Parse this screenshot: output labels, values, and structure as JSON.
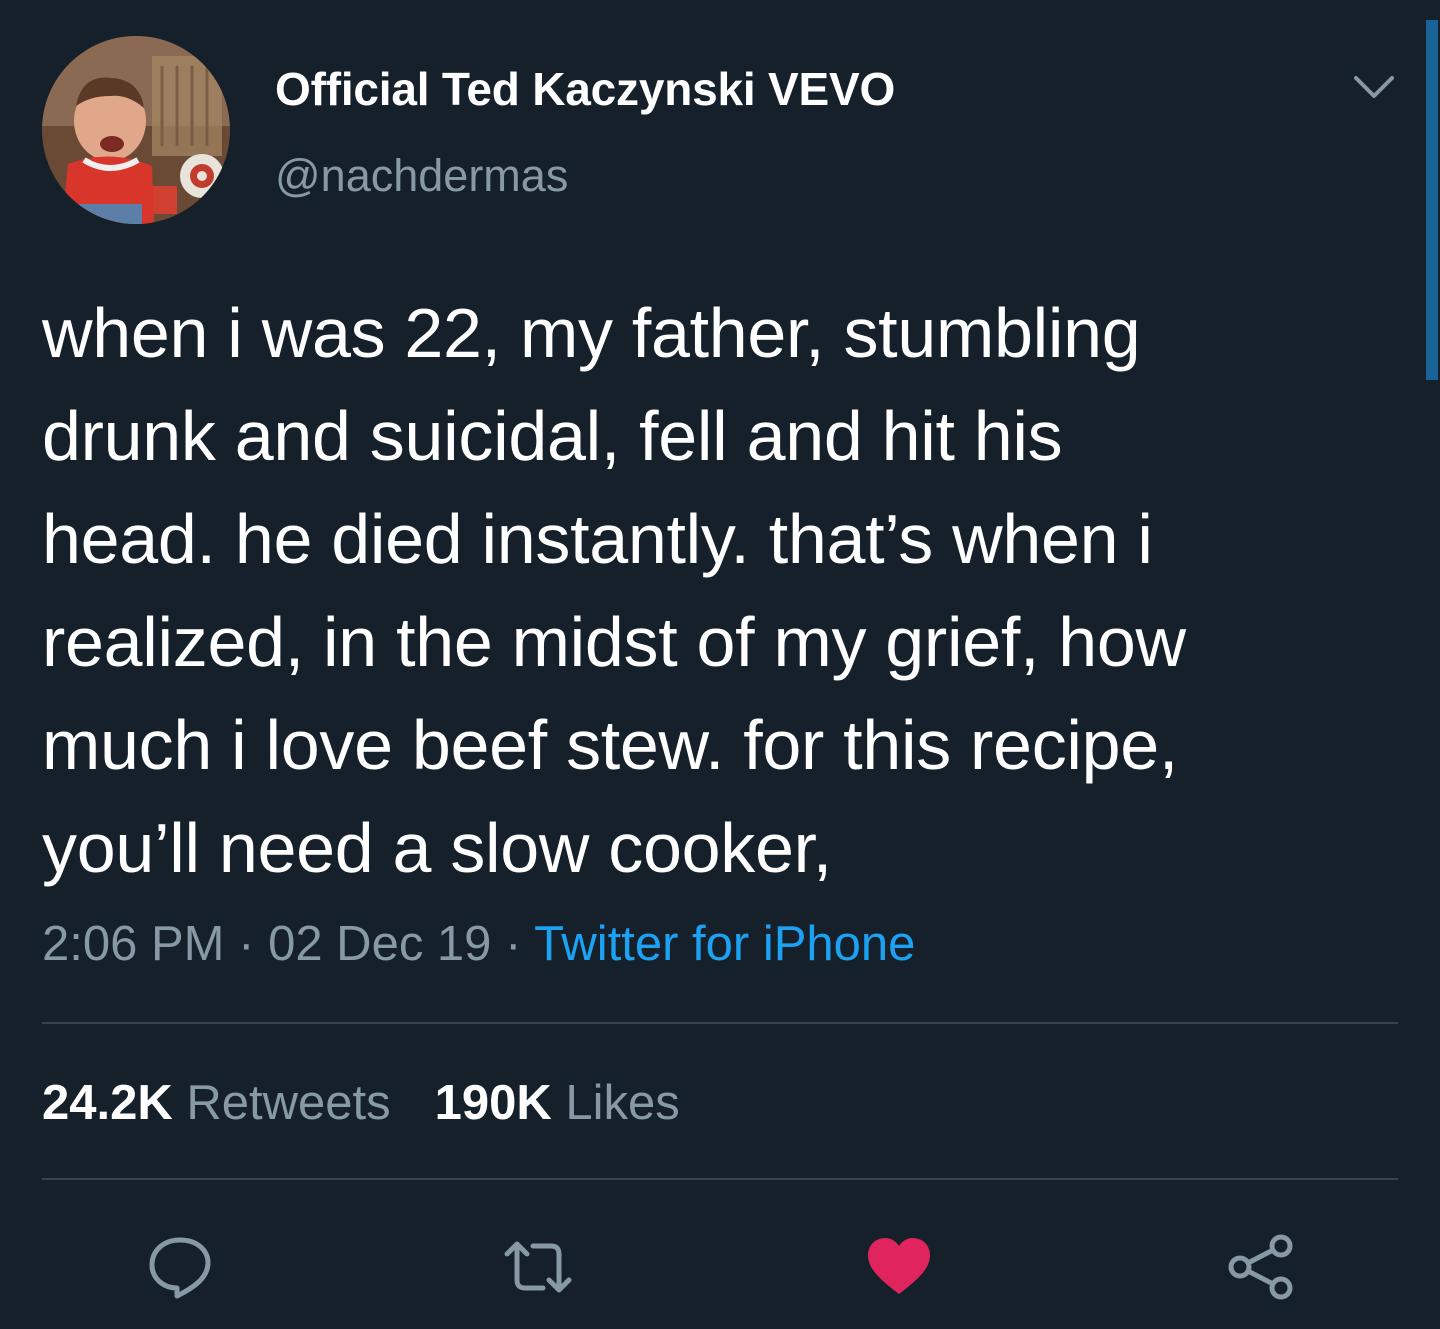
{
  "user": {
    "display_name": "Official Ted Kaczynski VEVO",
    "handle": "@nachdermas",
    "avatar_icon": "profile-photo-toddler"
  },
  "tweet": {
    "text": "when i was 22, my father, stumbling\ndrunk and suicidal, fell and hit his\nhead. he died instantly. that’s when i\nrealized, in the midst of my grief, how\nmuch i love beef stew. for this recipe,\nyou’ll need a slow cooker,",
    "time": "2:06 PM",
    "separator": "·",
    "date": "02 Dec 19",
    "source": "Twitter for iPhone"
  },
  "stats": {
    "retweets_count": "24.2K",
    "retweets_label": "Retweets",
    "likes_count": "190K",
    "likes_label": "Likes"
  },
  "actions": [
    {
      "icon": "reply-icon"
    },
    {
      "icon": "retweet-icon"
    },
    {
      "icon": "heart-icon",
      "active": true
    },
    {
      "icon": "share-icon"
    }
  ],
  "colors": {
    "background": "#15202b",
    "secondary_text": "#8899a6",
    "link": "#1da1f2",
    "liked": "#e0245e",
    "divider": "#38444d"
  }
}
